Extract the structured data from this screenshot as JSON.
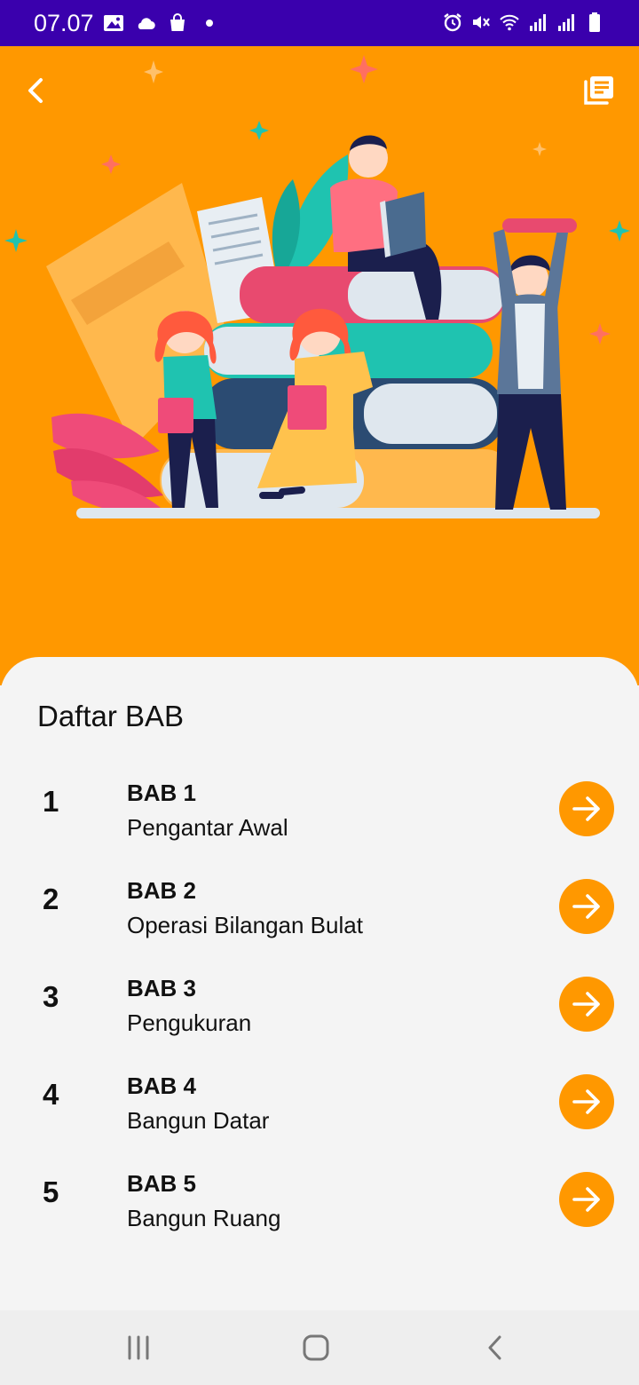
{
  "status_bar": {
    "time": "07.07",
    "left_icons": [
      "image-icon",
      "cloud-icon",
      "bag-icon",
      "dot-icon"
    ],
    "right_icons": [
      "alarm-icon",
      "mute-icon",
      "wifi-icon",
      "signal-icon",
      "signal-icon",
      "battery-icon"
    ]
  },
  "header": {
    "back_icon": "chevron-left-icon",
    "library_icon": "library-icon",
    "accent_color": "#ff9800"
  },
  "chapters_section": {
    "title": "Daftar BAB",
    "items": [
      {
        "number": "1",
        "code": "BAB 1",
        "name": "Pengantar Awal"
      },
      {
        "number": "2",
        "code": "BAB 2",
        "name": "Operasi Bilangan Bulat"
      },
      {
        "number": "3",
        "code": "BAB 3",
        "name": "Pengukuran"
      },
      {
        "number": "4",
        "code": "BAB 4",
        "name": "Bangun Datar"
      },
      {
        "number": "5",
        "code": "BAB 5",
        "name": "Bangun Ruang"
      }
    ]
  },
  "nav_bar": {
    "buttons": [
      "recents-icon",
      "home-icon",
      "back-icon"
    ]
  }
}
